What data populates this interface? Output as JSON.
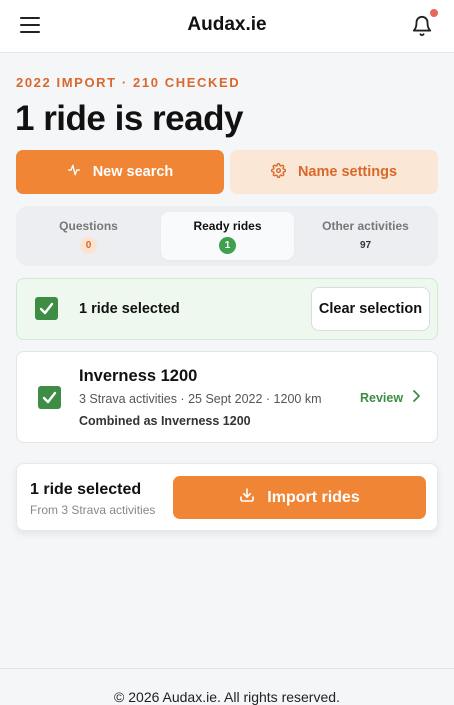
{
  "header": {
    "title": "Audax.ie"
  },
  "summary": {
    "eyebrow": "2022 IMPORT · 210 CHECKED",
    "headline": "1 ride is ready"
  },
  "actions": {
    "new_search": "New search",
    "name_settings": "Name settings"
  },
  "tabs": [
    {
      "label": "Questions",
      "count": "0"
    },
    {
      "label": "Ready rides",
      "count": "1"
    },
    {
      "label": "Other activities",
      "count": "97"
    }
  ],
  "selection": {
    "text": "1 ride selected",
    "clear_label": "Clear selection"
  },
  "ride": {
    "title": "Inverness 1200",
    "meta": "3 Strava activities · 25 Sept 2022 · 1200 km",
    "combined": "Combined as Inverness 1200",
    "review_label": "Review"
  },
  "import_panel": {
    "title": "1 ride selected",
    "subtitle": "From 3 Strava activities",
    "button_label": "Import rides"
  },
  "footer": {
    "copyright": "© 2026 Audax.ie. All rights reserved."
  },
  "colors": {
    "accent": "#ef8535",
    "accent_soft": "#fbe7d6",
    "success": "#3d8d45",
    "notification": "#e8665a"
  },
  "icons": {
    "menu": "menu-icon",
    "bell": "bell-icon",
    "new_search": "activity-icon",
    "name_settings": "gear-icon",
    "checkbox": "check-icon",
    "review": "chevron-right-icon",
    "import": "download-icon"
  }
}
